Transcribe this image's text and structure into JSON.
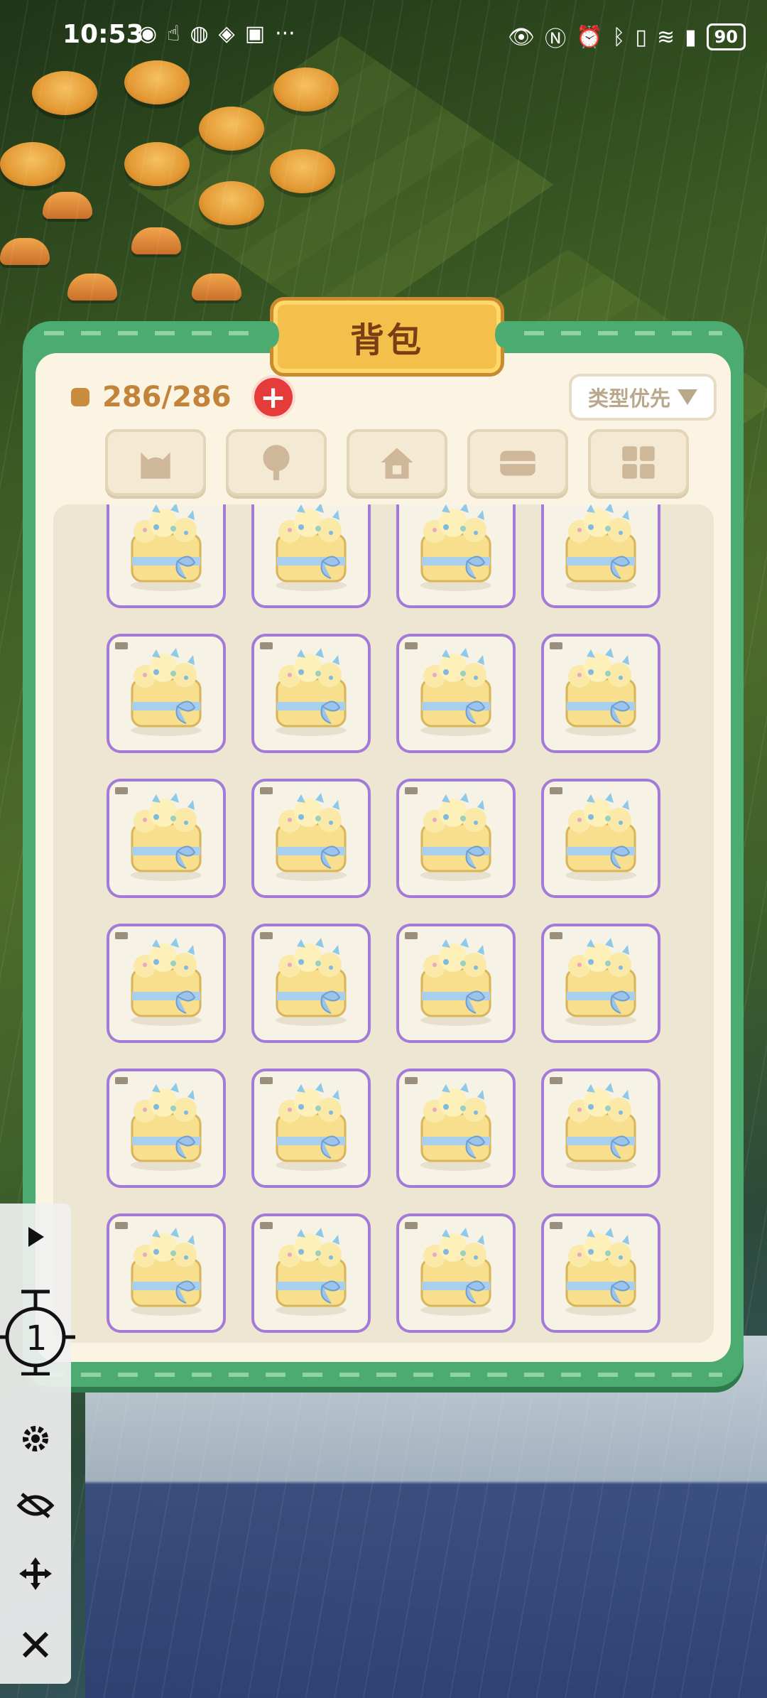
{
  "status_bar": {
    "time": "10:53",
    "battery": "90",
    "left_icons": [
      "weibo-icon",
      "touch-icon",
      "wechat-icon",
      "vpn-icon",
      "huawei-icon",
      "more-icon"
    ],
    "right_icons": [
      "eye-icon",
      "nfc-icon",
      "alarm-icon",
      "bluetooth-icon",
      "vibrate-icon",
      "wifi-icon",
      "signal-4g-icon",
      "battery-icon"
    ]
  },
  "panel": {
    "title": "背包",
    "capacity": "286/286",
    "sort_label": "类型优先",
    "filter_tabs": [
      "cat-icon",
      "tree-icon",
      "house-icon",
      "chest-icon",
      "grid-icon"
    ]
  },
  "inventory": {
    "item_name": "cake-box-item",
    "rows": 6,
    "columns": 4,
    "rarity_color": "#a37ad8"
  },
  "control_bar": {
    "counter": "1",
    "buttons": [
      "play-icon",
      "settings-icon",
      "hide-icon",
      "move-icon",
      "close-icon"
    ]
  },
  "colors": {
    "panel_green": "#4cab70",
    "title_gold": "#f3c04b",
    "capacity_brown": "#c2843a",
    "add_red": "#e43b3b"
  }
}
